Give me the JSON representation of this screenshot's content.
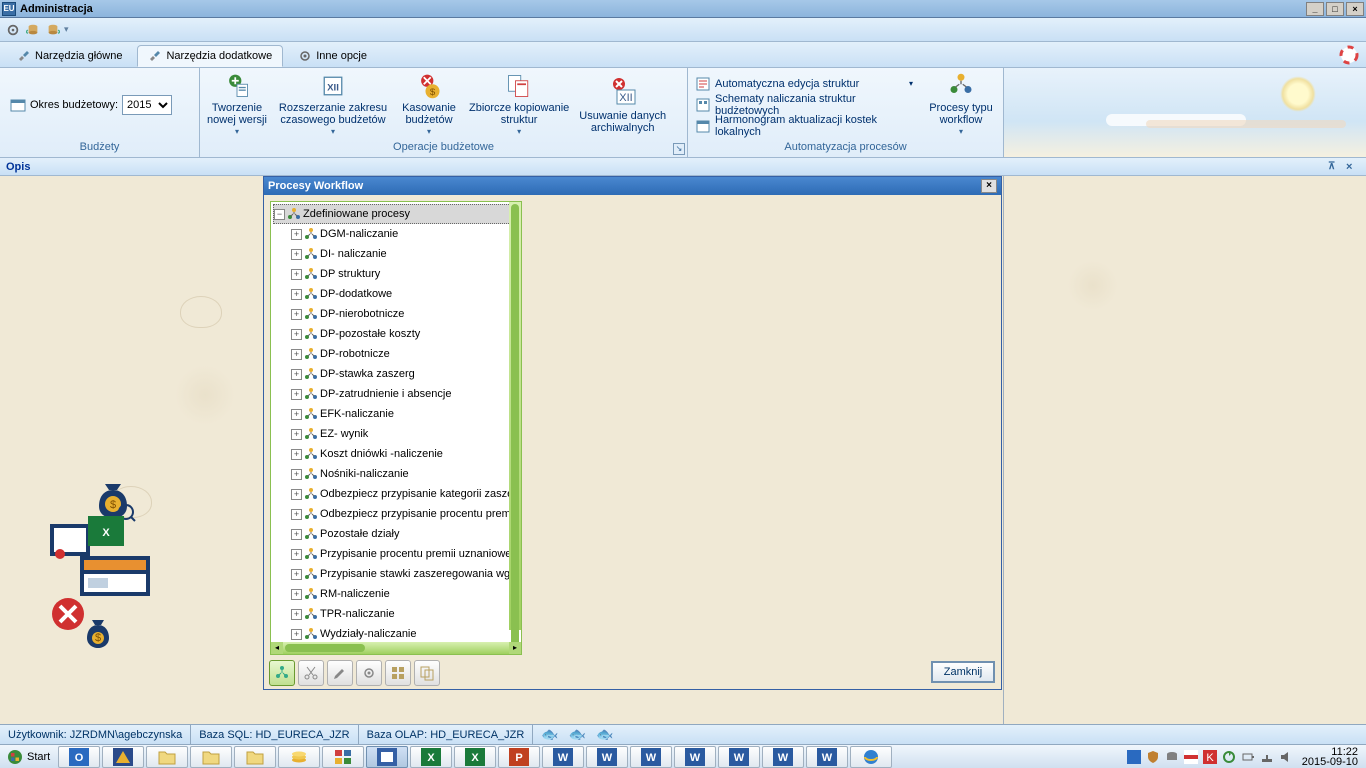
{
  "window": {
    "title": "Administracja"
  },
  "ribbon": {
    "tabs": [
      {
        "label": "Narzędzia główne"
      },
      {
        "label": "Narzędzia dodatkowe"
      },
      {
        "label": "Inne opcje"
      }
    ],
    "active_tab": 1,
    "budget_group": {
      "okres_label": "Okres budżetowy:",
      "okres_value": "2015",
      "label": "Budżety"
    },
    "ops_group": {
      "btn_tworzenie": "Tworzenie\nnowej wersji",
      "btn_rozszerz": "Rozszerzanie zakresu\nczasowego budżetów",
      "btn_kasowanie": "Kasowanie\nbudżetów",
      "btn_zbiorcze": "Zbiorcze kopiowanie\nstruktur",
      "btn_usuwanie": "Usuwanie danych\narchiwalnych",
      "label": "Operacje budżetowe"
    },
    "auto_group": {
      "btn_auto_edycja": "Automatyczna edycja struktur",
      "btn_schematy": "Schematy naliczania struktur budżetowych",
      "btn_harmonogram": "Harmonogram aktualizacji kostek lokalnych",
      "btn_procesy": "Procesy typu\nworkflow",
      "label": "Automatyzacja procesów"
    }
  },
  "opis_panel": {
    "title": "Opis"
  },
  "workflow_window": {
    "title": "Procesy Workflow",
    "root_label": "Zdefiniowane procesy",
    "items": [
      "DGM-naliczanie",
      "DI- naliczanie",
      "DP struktury",
      "DP-dodatkowe",
      "DP-nierobotnicze",
      "DP-pozostałe koszty",
      "DP-robotnicze",
      "DP-stawka zaszerg",
      "DP-zatrudnienie i absencje",
      "EFK-naliczanie",
      "EZ- wynik",
      "Koszt dniówki -naliczenie",
      "Nośniki-naliczanie",
      "Odbezpiecz przypisanie kategorii zaszer",
      "Odbezpiecz przypisanie procentu premii",
      "Pozostałe działy",
      "Przypisanie procentu premii uznaniowej",
      "Przypisanie stawki zaszeregowania wg l",
      "RM-naliczenie",
      "TPR-naliczanie",
      "Wydziały-naliczanie"
    ],
    "close_label": "Zamknij"
  },
  "status": {
    "user": "Użytkownik: JZRDMN\\agebczynska",
    "sql": "Baza SQL: HD_EURECA_JZR",
    "olap": "Baza OLAP: HD_EURECA_JZR"
  },
  "taskbar": {
    "start": "Start",
    "clock_time": "11:22",
    "clock_date": "2015-09-10"
  }
}
